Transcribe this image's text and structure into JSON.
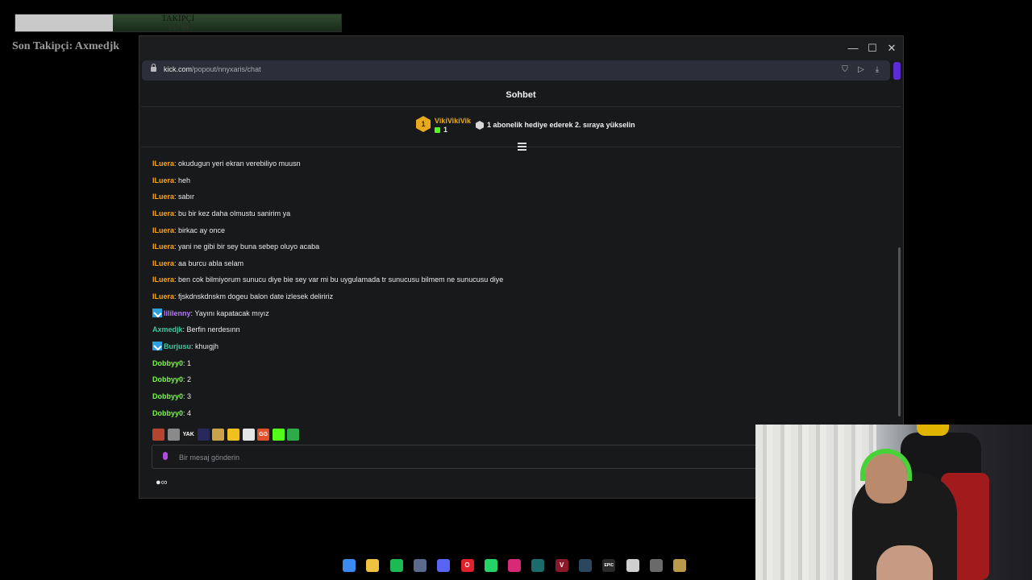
{
  "overlay": {
    "follower_bar_label": "TAKİPÇİ",
    "follower_count": "15 / 50",
    "follower_progress": 0.3,
    "last_follower": "Son Takipçi: Axmedjk"
  },
  "window": {
    "controls": {
      "minimize": "—",
      "maximize": "☐",
      "close": "✕"
    }
  },
  "address_bar": {
    "url_domain": "kick.com",
    "url_path": "/popout/nnyxaris/chat",
    "icons": [
      "shield-icon",
      "send-icon",
      "download-icon"
    ]
  },
  "chat": {
    "title": "Sohbet",
    "top_gifter": {
      "rank": "1",
      "name": "VikiVikiVik",
      "count": "1"
    },
    "promo_text": "1 abonelik hediye ederek 2. sıraya yükselin",
    "messages": [
      {
        "user": "ILuera",
        "color": "#f5a623",
        "text": ": okudugun yeri ekran verebiliyo muusn",
        "badge": false
      },
      {
        "user": "ILuera",
        "color": "#f5a623",
        "text": ": heh",
        "badge": false
      },
      {
        "user": "ILuera",
        "color": "#f5a623",
        "text": ": sabır",
        "badge": false
      },
      {
        "user": "ILuera",
        "color": "#f5a623",
        "text": ": bu bir kez daha olmustu sanirim ya",
        "badge": false
      },
      {
        "user": "ILuera",
        "color": "#f5a623",
        "text": ": birkac ay once",
        "badge": false
      },
      {
        "user": "ILuera",
        "color": "#f5a623",
        "text": ": yani ne gibi bir sey buna sebep oluyo acaba",
        "badge": false
      },
      {
        "user": "ILuera",
        "color": "#f5a623",
        "text": ": aa burcu abla selam",
        "badge": false
      },
      {
        "user": "ILuera",
        "color": "#f5a623",
        "text": ": ben cok bilmiyorum sunucu diye bie sey var mi bu uygulamada tr sunucusu bilmem ne sunucusu diye",
        "badge": false
      },
      {
        "user": "ILuera",
        "color": "#f5a623",
        "text": ": fjskdnskdnskm dogeu balon date izlesek deliririz",
        "badge": false
      },
      {
        "user": "lililenny",
        "color": "#b57cf5",
        "text": ": Yayını kapatacak mıyız",
        "badge": true
      },
      {
        "user": "Axmedjk",
        "color": "#3ec7a0",
        "text": ": Berfin nerdesınn",
        "badge": false
      },
      {
        "user": "Burjusu",
        "color": "#3ec7a0",
        "text": ": khuıgjh",
        "badge": true
      },
      {
        "user": "Dobbyy0",
        "color": "#7cf54a",
        "text": ": 1",
        "badge": false
      },
      {
        "user": "Dobbyy0",
        "color": "#7cf54a",
        "text": ": 2",
        "badge": false
      },
      {
        "user": "Dobbyy0",
        "color": "#7cf54a",
        "text": ": 3",
        "badge": false
      },
      {
        "user": "Dobbyy0",
        "color": "#7cf54a",
        "text": ": 4",
        "badge": false
      }
    ],
    "emotes": [
      {
        "name": "emote-1",
        "color": "#b3452f",
        "label": ""
      },
      {
        "name": "emote-2",
        "color": "#8a8a8a",
        "label": ""
      },
      {
        "name": "emote-yak",
        "color": "#1a1a1a",
        "label": "YAK"
      },
      {
        "name": "emote-4",
        "color": "#28285c",
        "label": ""
      },
      {
        "name": "emote-5",
        "color": "#c9a24a",
        "label": ""
      },
      {
        "name": "emote-6",
        "color": "#f0c020",
        "label": ""
      },
      {
        "name": "emote-7",
        "color": "#e6e6e6",
        "label": ""
      },
      {
        "name": "emote-gg",
        "color": "#e0502a",
        "label": "GG"
      },
      {
        "name": "emote-9",
        "color": "#53fc18",
        "label": ""
      },
      {
        "name": "emote-10",
        "color": "#2eaa4a",
        "label": ""
      }
    ],
    "input_placeholder": "Bir mesaj gönderin",
    "footer_icon_text": "∞"
  },
  "taskbar": [
    {
      "name": "windows-start-icon",
      "color": "#3b8cf0",
      "label": ""
    },
    {
      "name": "file-explorer-icon",
      "color": "#f0c040",
      "label": ""
    },
    {
      "name": "spotify-icon",
      "color": "#1db954",
      "label": ""
    },
    {
      "name": "app-circle-icon",
      "color": "#5a6a8a",
      "label": ""
    },
    {
      "name": "discord-icon",
      "color": "#5865f2",
      "label": ""
    },
    {
      "name": "opera-icon",
      "color": "#e0202a",
      "label": "O"
    },
    {
      "name": "whatsapp-icon",
      "color": "#25d366",
      "label": ""
    },
    {
      "name": "instagram-icon",
      "color": "#d62976",
      "label": ""
    },
    {
      "name": "league-icon",
      "color": "#1b6b6b",
      "label": ""
    },
    {
      "name": "valorant-icon",
      "color": "#8a1a2a",
      "label": "V"
    },
    {
      "name": "steam-icon",
      "color": "#2a475e",
      "label": ""
    },
    {
      "name": "epic-games-icon",
      "color": "#2a2a2a",
      "label": "EPIC"
    },
    {
      "name": "app-ring-icon",
      "color": "#cfcfcf",
      "label": ""
    },
    {
      "name": "app-notification-icon",
      "color": "#6a6a6a",
      "label": ""
    },
    {
      "name": "league-client-icon",
      "color": "#b89a4a",
      "label": ""
    }
  ]
}
